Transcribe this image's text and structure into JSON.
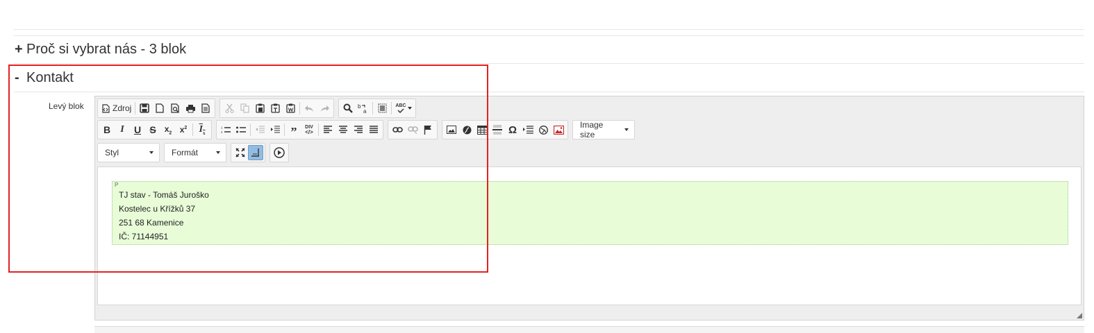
{
  "sections": {
    "collapsed": {
      "sign": "+",
      "title": "Proč si vybrat nás - 3 blok"
    },
    "expanded": {
      "sign": "-",
      "title": "Kontakt"
    }
  },
  "field": {
    "label": "Levý blok"
  },
  "toolbar": {
    "source_label": "Zdroj",
    "style_combo": "Styl",
    "format_combo": "Formát",
    "image_size_combo": "Image size",
    "spell_abc": "ABC",
    "showblocks_div": "DIV"
  },
  "content": {
    "element_marker": "P",
    "lines": [
      "TJ stav - Tomáš Juroško",
      "Kostelec u Křížků 37",
      "251 68 Kamenice",
      "IČ: 71144951"
    ]
  },
  "colors": {
    "highlight_border": "#e42020",
    "paragraph_background": "#e8fcd8",
    "active_button": "#92bce1"
  },
  "icons": [
    "source-icon",
    "save-icon",
    "new-page-icon",
    "preview-icon",
    "print-icon",
    "templates-icon",
    "cut-icon",
    "copy-icon",
    "paste-icon",
    "paste-text-icon",
    "paste-word-icon",
    "undo-icon",
    "redo-icon",
    "find-icon",
    "replace-icon",
    "select-all-icon",
    "spellcheck-icon",
    "bold-icon",
    "italic-icon",
    "underline-icon",
    "strikethrough-icon",
    "subscript-icon",
    "superscript-icon",
    "remove-format-icon",
    "numbered-list-icon",
    "bulleted-list-icon",
    "outdent-icon",
    "indent-icon",
    "blockquote-icon",
    "create-div-icon",
    "align-left-icon",
    "align-center-icon",
    "align-right-icon",
    "justify-icon",
    "link-icon",
    "unlink-icon",
    "anchor-icon",
    "image-icon",
    "flash-icon",
    "table-icon",
    "horizontal-line-icon",
    "special-char-icon",
    "page-break-icon",
    "iframe-icon",
    "image-red-icon",
    "maximize-icon",
    "show-blocks-icon",
    "preview-play-icon"
  ]
}
